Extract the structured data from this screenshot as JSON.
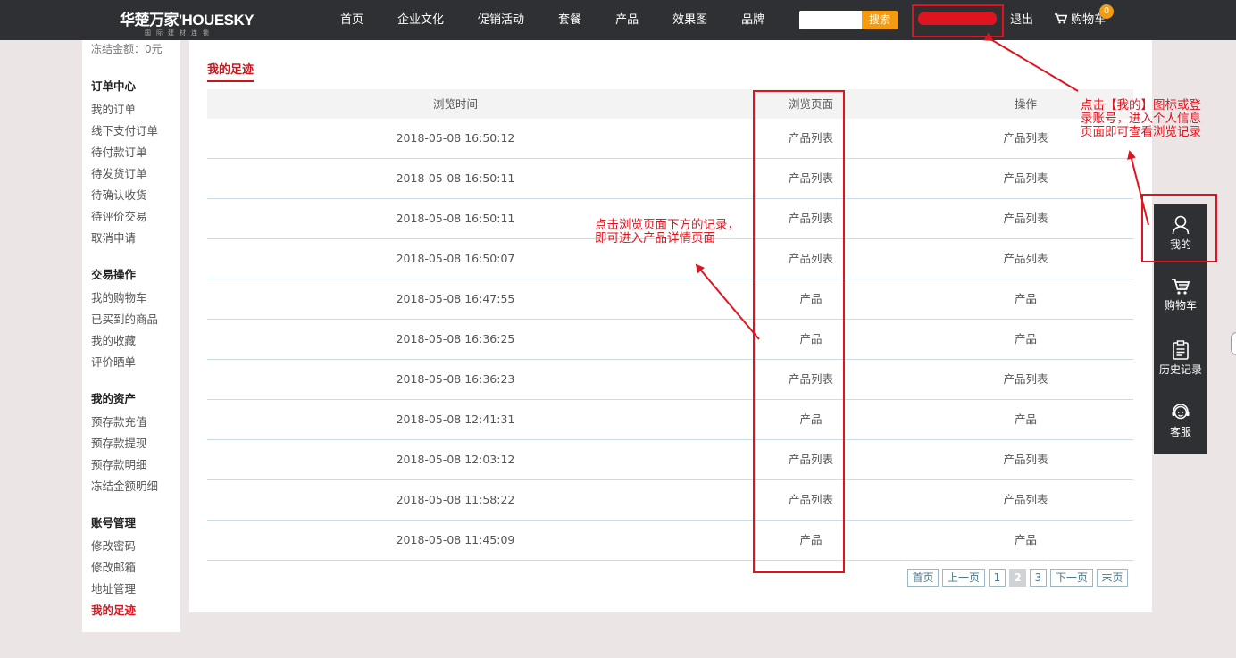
{
  "header": {
    "logo_main": "华楚万家'HOUESKY",
    "logo_sub": "国际建材连锁",
    "nav": [
      "首页",
      "企业文化",
      "促销活动",
      "套餐",
      "产品",
      "效果图",
      "品牌"
    ],
    "search_placeholder": "",
    "search_label": "搜索",
    "logout_label": "退出",
    "cart_label": "购物车",
    "cart_count": "0"
  },
  "sidebar": {
    "frozen_amount": "冻结金额：0元",
    "groups": [
      {
        "title": "订单中心",
        "items": [
          "我的订单",
          "线下支付订单",
          "待付款订单",
          "待发货订单",
          "待确认收货",
          "待评价交易",
          "取消申请"
        ]
      },
      {
        "title": "交易操作",
        "items": [
          "我的购物车",
          "已买到的商品",
          "我的收藏",
          "评价晒单"
        ]
      },
      {
        "title": "我的资产",
        "items": [
          "预存款充值",
          "预存款提现",
          "预存款明细",
          "冻结金额明细"
        ]
      },
      {
        "title": "账号管理",
        "items": [
          "修改密码",
          "修改邮箱",
          "地址管理",
          "我的足迹"
        ]
      }
    ],
    "active_item": "我的足迹"
  },
  "main": {
    "title": "我的足迹",
    "columns": [
      "浏览时间",
      "浏览页面",
      "操作"
    ],
    "rows": [
      [
        "2018-05-08 16:50:12",
        "产品列表",
        "产品列表"
      ],
      [
        "2018-05-08 16:50:11",
        "产品列表",
        "产品列表"
      ],
      [
        "2018-05-08 16:50:11",
        "产品列表",
        "产品列表"
      ],
      [
        "2018-05-08 16:50:07",
        "产品列表",
        "产品列表"
      ],
      [
        "2018-05-08 16:47:55",
        "产品",
        "产品"
      ],
      [
        "2018-05-08 16:36:25",
        "产品",
        "产品"
      ],
      [
        "2018-05-08 16:36:23",
        "产品列表",
        "产品列表"
      ],
      [
        "2018-05-08 12:41:31",
        "产品",
        "产品"
      ],
      [
        "2018-05-08 12:03:12",
        "产品列表",
        "产品列表"
      ],
      [
        "2018-05-08 11:58:22",
        "产品列表",
        "产品列表"
      ],
      [
        "2018-05-08 11:45:09",
        "产品",
        "产品"
      ]
    ],
    "pagination": [
      "首页",
      "上一页",
      "1",
      "2",
      "3",
      "下一页",
      "末页"
    ],
    "current_page": "2"
  },
  "float_bar": [
    {
      "label": "我的",
      "icon": "user-icon"
    },
    {
      "label": "购物车",
      "icon": "cart-icon"
    },
    {
      "label": "历史记录",
      "icon": "history-icon"
    },
    {
      "label": "客服",
      "icon": "customer-service-icon"
    }
  ],
  "annotations": {
    "right_note": "点击【我的】图标或登录账号，进入个人信息页面即可查看浏览记录",
    "center_note": "点击浏览页面下方的记录，即可进入产品详情页面",
    "color": "#e0141e"
  },
  "colors": {
    "topbar": "#2e3033",
    "accent_orange": "#f39c12",
    "accent_red": "#c8161d",
    "page_bg": "#ebe6e5"
  }
}
